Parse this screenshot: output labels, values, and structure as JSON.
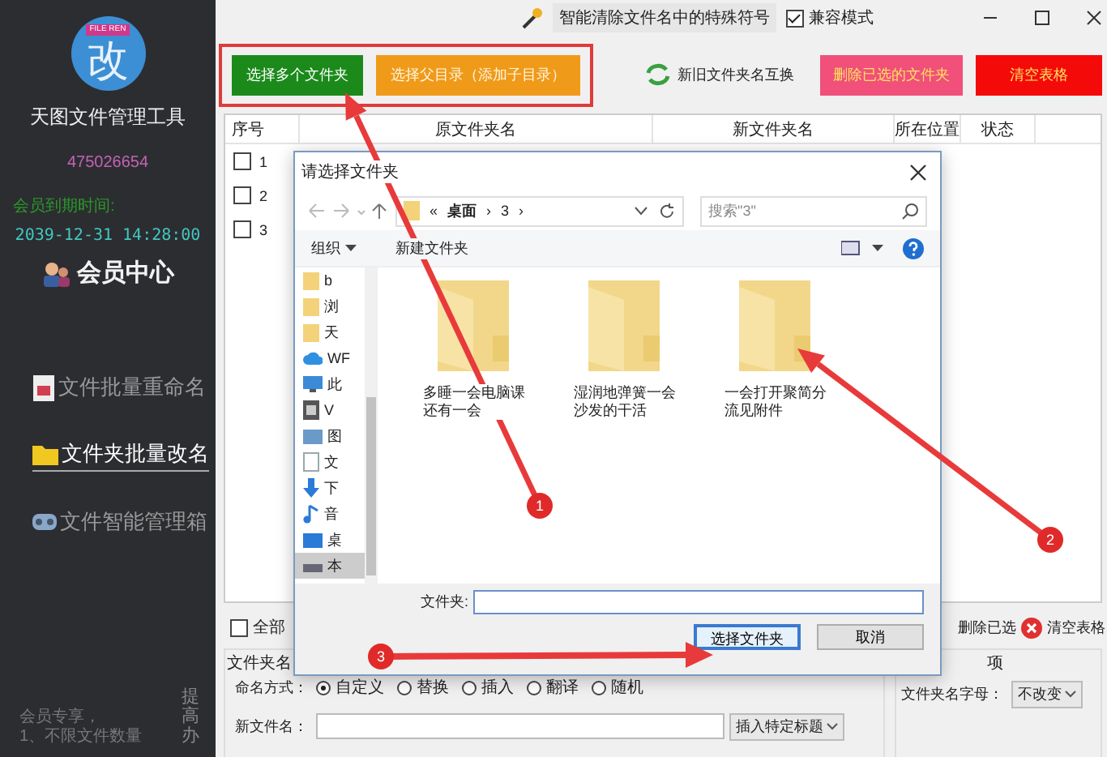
{
  "topbar": {
    "clean_link": "智能清除文件名中的特殊符号",
    "compat_mode": {
      "label": "兼容模式",
      "checked": true
    }
  },
  "sidebar": {
    "logo_banner": "FILE REN",
    "logo_text": "改",
    "app_name": "天图文件管理工具",
    "user_id": "475026654",
    "expiry_label": "会员到期时间:",
    "expiry_date": "2039-12-31 14:28:00",
    "member_center": "会员中心",
    "nav": [
      {
        "label": "文件批量重命名",
        "kind": "file",
        "selected": false
      },
      {
        "label": "文件夹批量改名",
        "kind": "folder",
        "selected": true
      },
      {
        "label": "文件智能管理箱",
        "kind": "box",
        "selected": false
      }
    ],
    "promo": [
      "会员专享，",
      "1、不限文件数量"
    ],
    "side_text": "提高办"
  },
  "toolbar": {
    "primary_buttons": [
      {
        "label": "选择多个文件夹",
        "color": "#1b8a1b"
      },
      {
        "label": "选择父目录（添加子目录）",
        "color": "#f09a1a"
      }
    ],
    "swap_button": "新旧文件夹名互换",
    "right_buttons": [
      {
        "label": "删除已选的文件夹",
        "color": "#f0507a"
      },
      {
        "label": "清空表格",
        "color": "#f50a0a"
      }
    ]
  },
  "table": {
    "columns": [
      "序号",
      "原文件夹名",
      "新文件夹名",
      "所在位置",
      "状态"
    ],
    "rows": [
      {
        "index": "1",
        "checked": false
      },
      {
        "index": "2",
        "checked": false
      },
      {
        "index": "3",
        "checked": false
      }
    ]
  },
  "bottom": {
    "select_all": {
      "label": "全部",
      "checked": false
    },
    "delete_selected": "删除已选",
    "clear_table": "清空表格",
    "group_title": "文件夹名",
    "right_group_title": "项",
    "naming": {
      "label": "命名方式：",
      "options": [
        {
          "label": "自定义",
          "selected": true
        },
        {
          "label": "替换",
          "selected": false
        },
        {
          "label": "插入",
          "selected": false
        },
        {
          "label": "翻译",
          "selected": false
        },
        {
          "label": "随机",
          "selected": false
        }
      ]
    },
    "new_name_label": "新文件名：",
    "insert_dropdown": "插入特定标题",
    "case_label": "文件夹名字母：",
    "case_value": "不改变"
  },
  "dialog": {
    "title": "请选择文件夹",
    "breadcrumb": [
      "«",
      "桌面",
      "›",
      "3",
      "›"
    ],
    "search_placeholder": "搜索\"3\"",
    "organize": "组织",
    "new_folder": "新建文件夹",
    "nav_items": [
      {
        "label": "b",
        "kind": "folder",
        "selected": false
      },
      {
        "label": "浏",
        "kind": "folder",
        "selected": false
      },
      {
        "label": "天",
        "kind": "folder",
        "selected": false
      },
      {
        "label": "WF",
        "kind": "cloud",
        "selected": false
      },
      {
        "label": "此",
        "kind": "pc",
        "selected": false
      },
      {
        "label": "V",
        "kind": "video",
        "selected": false
      },
      {
        "label": "图",
        "kind": "pictures",
        "selected": false
      },
      {
        "label": "文",
        "kind": "docs",
        "selected": false
      },
      {
        "label": "下",
        "kind": "downloads",
        "selected": false
      },
      {
        "label": "音",
        "kind": "music",
        "selected": false
      },
      {
        "label": "桌",
        "kind": "desktop",
        "selected": false
      },
      {
        "label": "本",
        "kind": "disk",
        "selected": true
      }
    ],
    "folders": [
      "多睡一会电脑课还有一会",
      "湿润地弹簧一会沙发的干活",
      "一会打开聚简分流见附件"
    ],
    "folder_label": "文件夹:",
    "ok_button": "选择文件夹",
    "cancel_button": "取消"
  },
  "steps": [
    "1",
    "2",
    "3"
  ]
}
